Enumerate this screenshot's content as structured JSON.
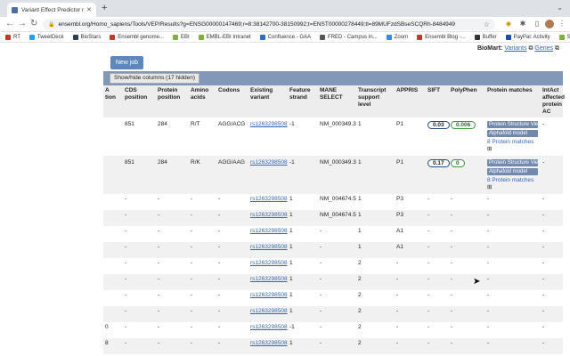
{
  "browser": {
    "tab_title": "Variant Effect Predictor results",
    "url": "ensembl.org/Homo_sapiens/Tools/VEP/Results?g=ENSG00000147469;r=8:38142700-38150992;t=ENST00000278449;tl=89MUFzdSBseSCQRh-8484949"
  },
  "bookmarks": [
    {
      "label": "RT",
      "color": "#c0392b"
    },
    {
      "label": "TweetDeck",
      "color": "#1da1f2"
    },
    {
      "label": "BioStars",
      "color": "#2c3e50"
    },
    {
      "label": "Ensembl genome...",
      "color": "#c0392b"
    },
    {
      "label": "EBI",
      "color": "#7fb03f"
    },
    {
      "label": "EMBL-EBI Intranet",
      "color": "#7fb03f"
    },
    {
      "label": "Confluence - GAA",
      "color": "#2c6ec0"
    },
    {
      "label": "FRED - Campus In...",
      "color": "#555"
    },
    {
      "label": "Zoom",
      "color": "#2d8cff"
    },
    {
      "label": "Ensembl Blog -...",
      "color": "#c0392b"
    },
    {
      "label": "Buffer",
      "color": "#333"
    },
    {
      "label": "PayPal: Activity",
      "color": "#1b4fa3"
    },
    {
      "label": "SAP",
      "color": "#7fb03f"
    }
  ],
  "page": {
    "biomart_label": "BioMart:",
    "biomart_variants": "Variants",
    "biomart_genes": "Genes",
    "new_job": "New job",
    "show_hide": "Show/hide columns (17 hidden)"
  },
  "columns": [
    "Allele position",
    "CDS position",
    "Protein position",
    "Amino acids",
    "Codons",
    "Existing variant",
    "Feature strand",
    "MANE SELECT",
    "Transcript support level",
    "APPRIS",
    "SIFT",
    "PolyPhen",
    "Protein matches",
    "IntAct affected protein AC"
  ],
  "column_headers_display": [
    "A\ntion",
    "CDS\nposition",
    "Protein\nposition",
    "Amino\nacids",
    "Codons",
    "Existing\nvariant",
    "Feature\nstrand",
    "MANE\nSELECT",
    "Transcript\nsupport\nlevel",
    "APPRIS",
    "SIFT",
    "PolyPhen",
    "Protein matches",
    "IntAct\naffected\nprotein\nAC"
  ],
  "protein_match_buttons": [
    "Protein Structure View",
    "Alphafold model"
  ],
  "protein_match_link": "8 Protein matches",
  "rows": [
    {
      "tall": true,
      "cells": [
        "",
        "851",
        "284",
        "R/T",
        "AGG/ACG",
        "rs1263298508",
        "-1",
        "NM_000349.3",
        "1",
        "P1",
        "0.03",
        "0.006",
        "PM",
        "-"
      ]
    },
    {
      "tall": true,
      "cells": [
        "",
        "851",
        "284",
        "R/K",
        "AGG/AAG",
        "rs1263298508",
        "-1",
        "NM_000349.3",
        "1",
        "P1",
        "0.17",
        "0",
        "PM",
        "-"
      ]
    },
    {
      "cells": [
        "",
        "-",
        "-",
        "-",
        "-",
        "rs1263298508",
        "1",
        "NM_004674.5",
        "1",
        "P3",
        "-",
        "-",
        "-",
        "-"
      ]
    },
    {
      "cells": [
        "",
        "-",
        "-",
        "-",
        "-",
        "rs1263298508",
        "1",
        "NM_004674.5",
        "1",
        "P3",
        "-",
        "-",
        "-",
        "-"
      ]
    },
    {
      "cells": [
        "",
        "-",
        "-",
        "-",
        "-",
        "rs1263298508",
        "1",
        "-",
        "1",
        "A1",
        "-",
        "-",
        "-",
        "-"
      ]
    },
    {
      "cells": [
        "",
        "-",
        "-",
        "-",
        "-",
        "rs1263298508",
        "1",
        "-",
        "1",
        "A1",
        "-",
        "-",
        "-",
        "-"
      ]
    },
    {
      "cells": [
        "",
        "-",
        "-",
        "-",
        "-",
        "rs1263298508",
        "1",
        "-",
        "2",
        "-",
        "-",
        "-",
        "-",
        "-"
      ]
    },
    {
      "cells": [
        "",
        "-",
        "-",
        "-",
        "-",
        "rs1263298508",
        "1",
        "-",
        "2",
        "-",
        "-",
        "-",
        "-",
        "-"
      ]
    },
    {
      "cells": [
        "",
        "-",
        "-",
        "-",
        "-",
        "rs1263298508",
        "1",
        "-",
        "2",
        "-",
        "-",
        "-",
        "-",
        "-"
      ]
    },
    {
      "cells": [
        "",
        "-",
        "-",
        "-",
        "-",
        "rs1263298508",
        "1",
        "-",
        "2",
        "-",
        "-",
        "-",
        "-",
        "-"
      ]
    },
    {
      "cells": [
        "0",
        "-",
        "-",
        "-",
        "-",
        "rs1263298508",
        "-1",
        "-",
        "2",
        "-",
        "-",
        "-",
        "-",
        "-"
      ]
    },
    {
      "cells": [
        "8",
        "-",
        "-",
        "-",
        "-",
        "rs1263298508",
        "1",
        "-",
        "2",
        "-",
        "-",
        "-",
        "-",
        "-"
      ]
    },
    {
      "cells": [
        "",
        "-",
        "-",
        "-",
        "-",
        "rs1263298508",
        "1",
        "-",
        "4",
        "-",
        "-",
        "-",
        "-",
        "-"
      ]
    }
  ]
}
